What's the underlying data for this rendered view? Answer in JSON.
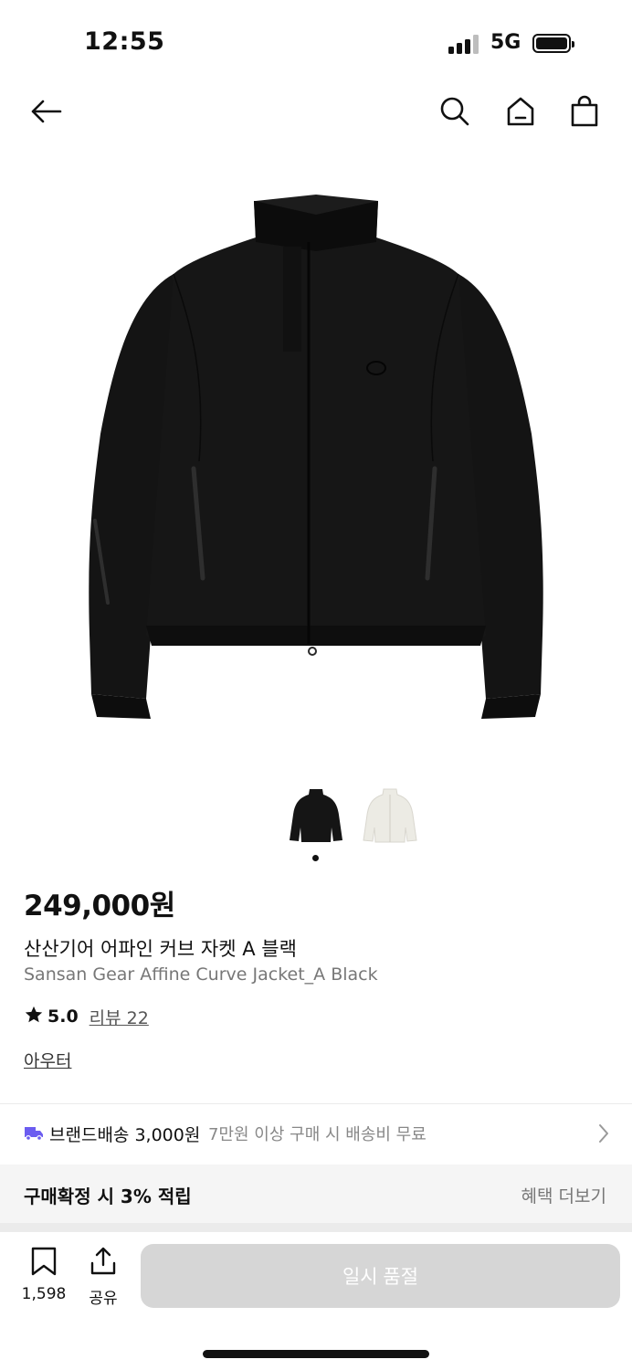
{
  "status_bar": {
    "time": "12:55",
    "network": "5G"
  },
  "nav": {
    "icons": [
      "back-arrow-icon",
      "search-icon",
      "home-icon",
      "shopping-bag-icon"
    ]
  },
  "product": {
    "price": "249,000원",
    "name_ko": "산산기어 어파인 커브 자켓 A 블랙",
    "name_en": "Sansan Gear Affine Curve Jacket_A Black",
    "rating": "5.0",
    "review_label": "리뷰 22",
    "category": "아우터",
    "image_count": 2,
    "selected_image": 1
  },
  "shipping": {
    "label": "브랜드배송 3,000원",
    "note": "7만원 이상 구매 시 배송비 무료"
  },
  "points": {
    "label": "구매확정 시 3% 적립",
    "more": "혜택 더보기"
  },
  "bottom_bar": {
    "bookmark_count": "1,598",
    "share_label": "공유",
    "soldout_label": "일시 품절"
  },
  "colors": {
    "accent_icon": "#6b5cf0",
    "disabled_button": "#d6d6d6"
  }
}
